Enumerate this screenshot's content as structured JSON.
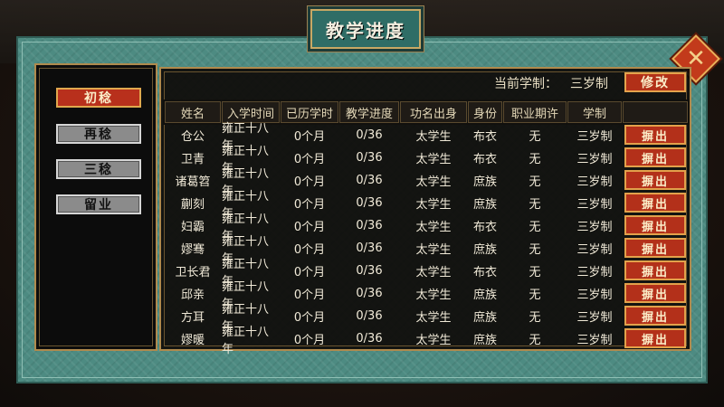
{
  "title": "教学进度",
  "tabs": [
    "初稔",
    "再稔",
    "三稔",
    "留业"
  ],
  "current_school_label": "当前学制：",
  "current_school_value": "三岁制",
  "modify_label": "修改",
  "columns": [
    "姓名",
    "入学时间",
    "已历学时",
    "教学进度",
    "功名出身",
    "身份",
    "职业期许",
    "学制"
  ],
  "expel_label": "摒出",
  "rows": [
    {
      "name": "仓公",
      "enroll": "雍正十八年",
      "elapsed": "0个月",
      "progress": "0/36",
      "origin": "太学生",
      "status": "布衣",
      "career": "无",
      "system": "三岁制"
    },
    {
      "name": "卫青",
      "enroll": "雍正十八年",
      "elapsed": "0个月",
      "progress": "0/36",
      "origin": "太学生",
      "status": "布衣",
      "career": "无",
      "system": "三岁制"
    },
    {
      "name": "诸葛笤",
      "enroll": "雍正十八年",
      "elapsed": "0个月",
      "progress": "0/36",
      "origin": "太学生",
      "status": "庶族",
      "career": "无",
      "system": "三岁制"
    },
    {
      "name": "蒯刻",
      "enroll": "雍正十八年",
      "elapsed": "0个月",
      "progress": "0/36",
      "origin": "太学生",
      "status": "庶族",
      "career": "无",
      "system": "三岁制"
    },
    {
      "name": "妇霸",
      "enroll": "雍正十八年",
      "elapsed": "0个月",
      "progress": "0/36",
      "origin": "太学生",
      "status": "布衣",
      "career": "无",
      "system": "三岁制"
    },
    {
      "name": "嫪骞",
      "enroll": "雍正十八年",
      "elapsed": "0个月",
      "progress": "0/36",
      "origin": "太学生",
      "status": "庶族",
      "career": "无",
      "system": "三岁制"
    },
    {
      "name": "卫长君",
      "enroll": "雍正十八年",
      "elapsed": "0个月",
      "progress": "0/36",
      "origin": "太学生",
      "status": "布衣",
      "career": "无",
      "system": "三岁制"
    },
    {
      "name": "邱亲",
      "enroll": "雍正十八年",
      "elapsed": "0个月",
      "progress": "0/36",
      "origin": "太学生",
      "status": "庶族",
      "career": "无",
      "system": "三岁制"
    },
    {
      "name": "方耳",
      "enroll": "雍正十八年",
      "elapsed": "0个月",
      "progress": "0/36",
      "origin": "太学生",
      "status": "庶族",
      "career": "无",
      "system": "三岁制"
    },
    {
      "name": "嫪暖",
      "enroll": "雍正十八年",
      "elapsed": "0个月",
      "progress": "0/36",
      "origin": "太学生",
      "status": "庶族",
      "career": "无",
      "system": "三岁制"
    }
  ],
  "colors": {
    "accent_red": "#b3301a",
    "frame_teal": "#4d8b82",
    "gold": "#e2a14b"
  }
}
